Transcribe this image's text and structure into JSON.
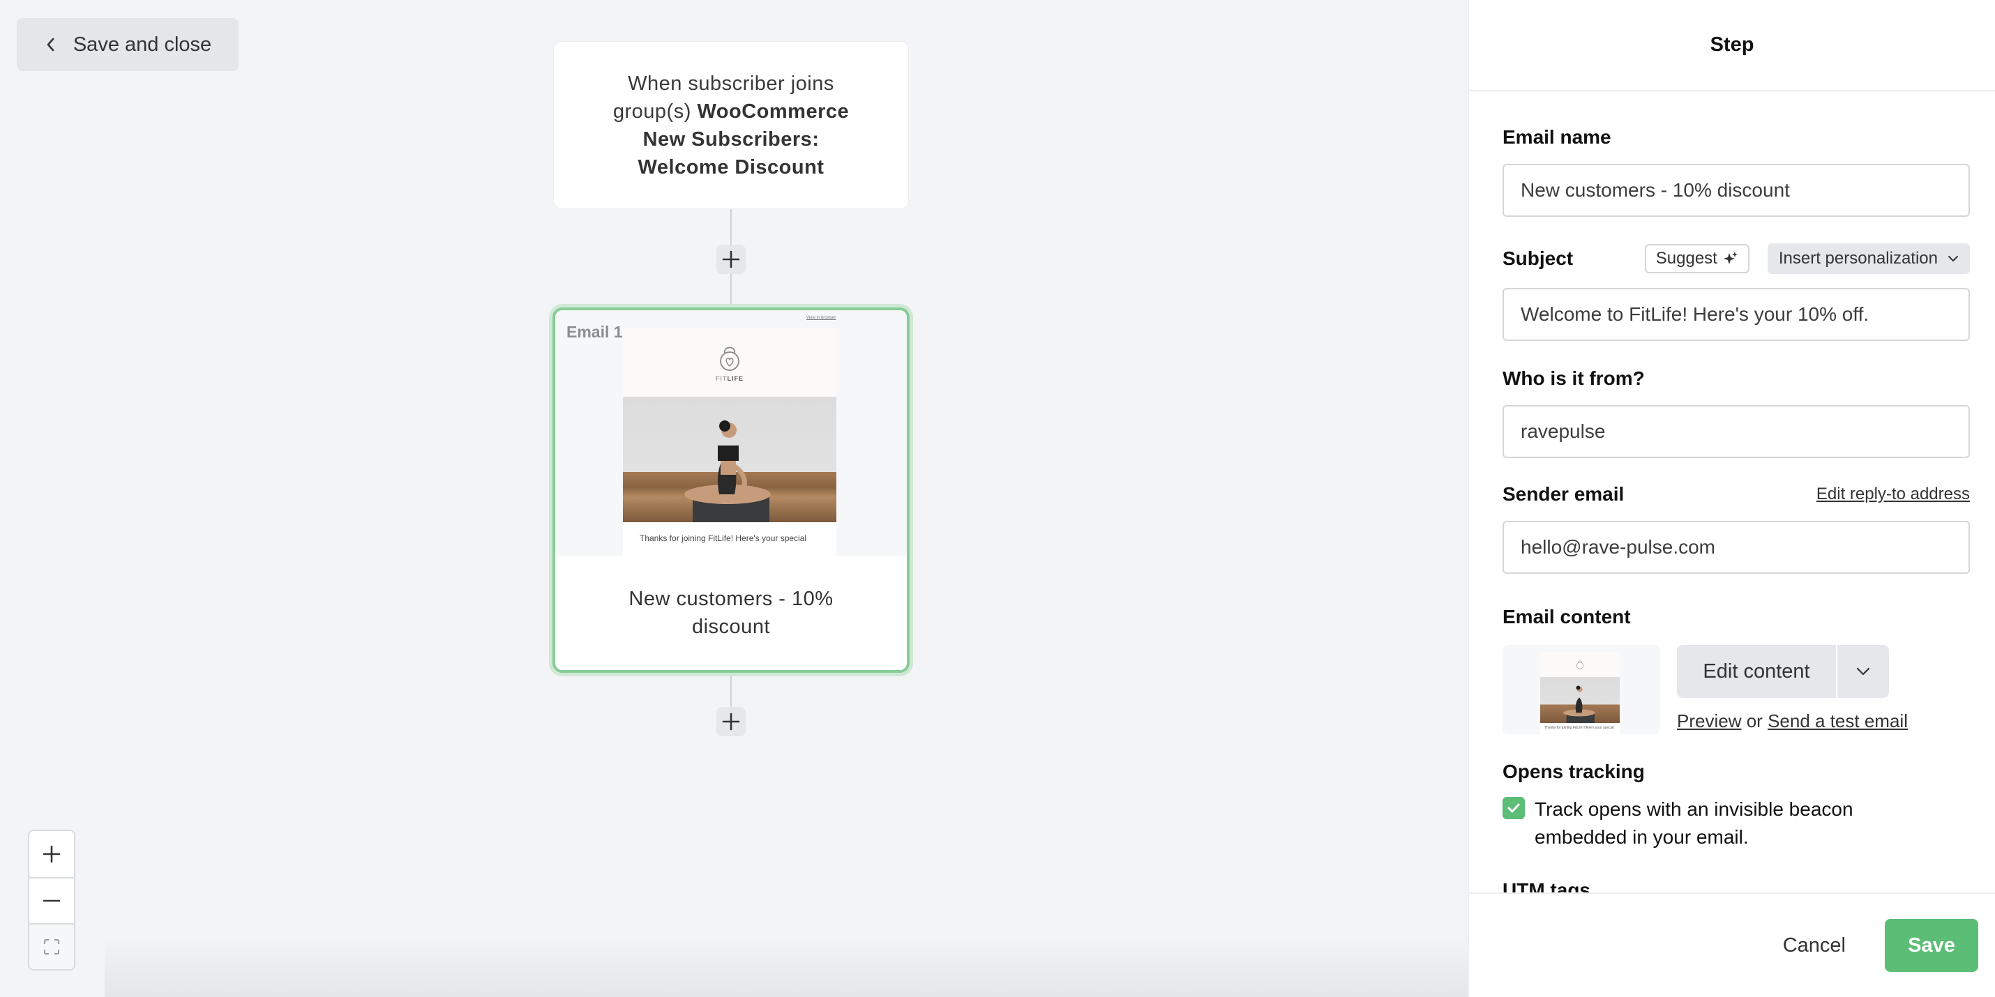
{
  "canvas": {
    "save_close_label": "Save and close",
    "trigger": {
      "prefix": "When subscriber joins group(s)",
      "group_name": "WooCommerce New Subscribers: Welcome Discount"
    },
    "email_step": {
      "label": "Email 1",
      "name": "New customers - 10% discount",
      "preview": {
        "view_in_browser": "View in browser",
        "brand_light": "FIT",
        "brand_bold": "LIFE",
        "intro_text": "Thanks for joining FitLife! Here's your special"
      }
    },
    "zoom_controls": {
      "zoom_in": "zoom-in",
      "zoom_out": "zoom-out",
      "fit": "fit-to-screen"
    },
    "colors": {
      "selected_border": "#88cc98",
      "selected_glow": "#cfe9d6"
    }
  },
  "panel": {
    "title": "Step",
    "email_name": {
      "label": "Email name",
      "value": "New customers - 10% discount"
    },
    "subject": {
      "label": "Subject",
      "suggest_label": "Suggest",
      "insert_personalization_label": "Insert personalization",
      "value": "Welcome to FitLife! Here's your 10% off."
    },
    "from": {
      "label": "Who is it from?",
      "value": "ravepulse"
    },
    "sender_email": {
      "label": "Sender email",
      "edit_reply_to_label": "Edit reply-to address",
      "value": "hello@rave-pulse.com"
    },
    "email_content": {
      "label": "Email content",
      "edit_content_label": "Edit content",
      "preview_label": "Preview",
      "or_text": "or",
      "send_test_label": "Send a test email",
      "thumb_text": "Thanks for joining FitLife! Here's your special"
    },
    "opens_tracking": {
      "label": "Opens tracking",
      "checkbox_label": "Track opens with an invisible beacon embedded in your email.",
      "checked": true
    },
    "utm_tags": {
      "label": "UTM tags"
    },
    "footer": {
      "cancel_label": "Cancel",
      "save_label": "Save"
    },
    "colors": {
      "accent_green": "#5cbd76"
    }
  }
}
